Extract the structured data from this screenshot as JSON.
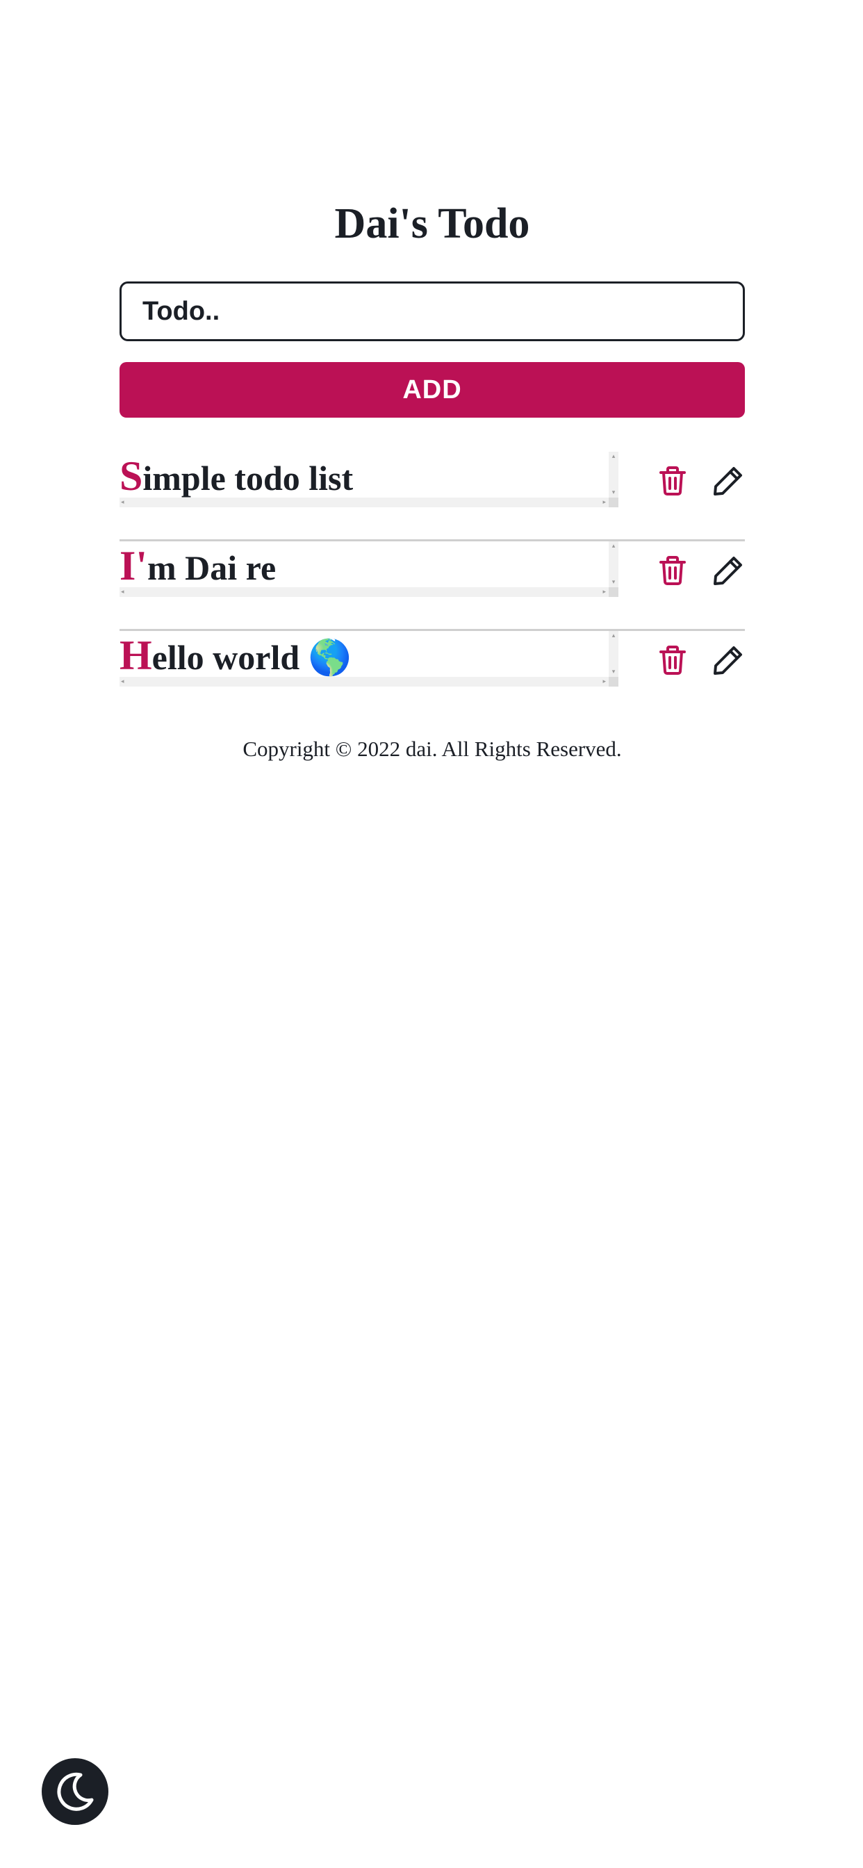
{
  "header": {
    "title": "Dai's Todo"
  },
  "form": {
    "input_placeholder": "Todo..",
    "input_value": "",
    "add_label": "ADD"
  },
  "todos": [
    {
      "first": "S",
      "rest": "imple todo list"
    },
    {
      "first": "I'",
      "rest": "m Dai re"
    },
    {
      "first": "H",
      "rest": "ello world 🌎"
    }
  ],
  "footer": {
    "copyright": "Copyright © 2022 dai. All Rights Reserved."
  },
  "icons": {
    "delete": "trash-icon",
    "edit": "pencil-icon",
    "theme": "moon-icon"
  },
  "colors": {
    "accent": "#bb1155",
    "text": "#1b1f26",
    "divider": "#cfcfcf"
  }
}
